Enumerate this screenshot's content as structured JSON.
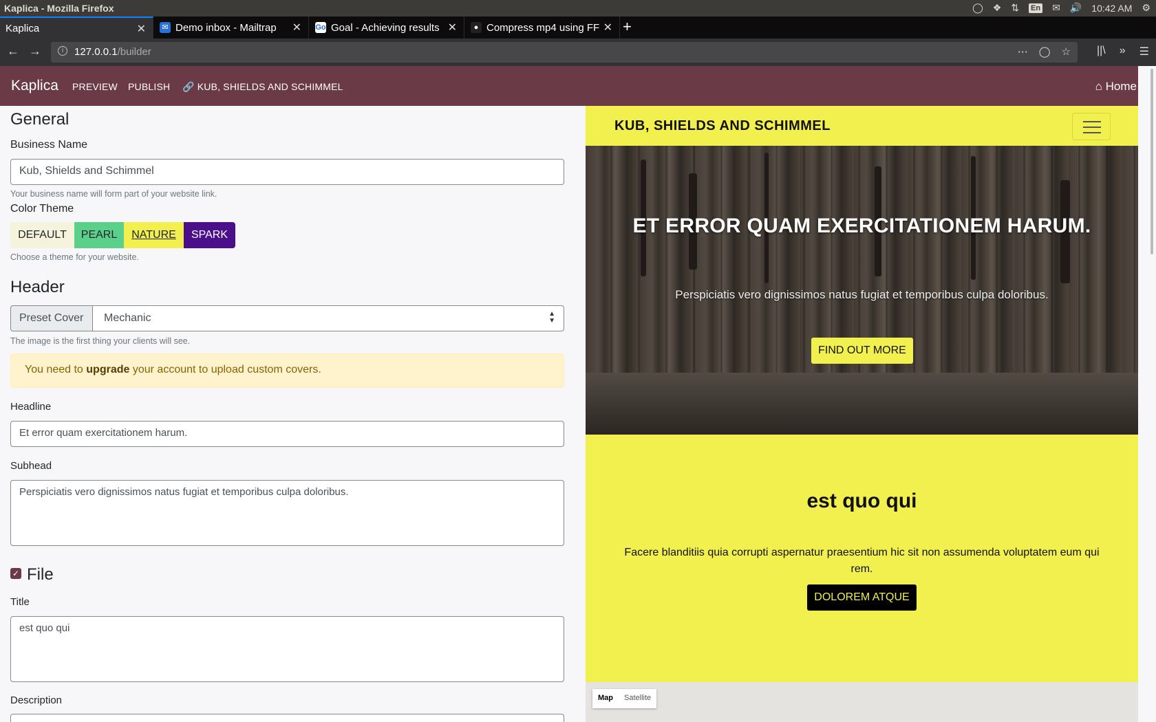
{
  "os": {
    "window_title": "Kaplica - Mozilla Firefox",
    "keyboard": "En",
    "clock": "10:42 AM"
  },
  "tabs": [
    {
      "label": "Kaplica",
      "icon": "page-icon",
      "active": true
    },
    {
      "label": "Demo inbox - Mailtrap",
      "icon": "mailtrap-icon"
    },
    {
      "label": "Goal - Achieving results",
      "icon": "go-icon"
    },
    {
      "label": "Compress mp4 using FF",
      "icon": "github-icon"
    }
  ],
  "browser": {
    "url_host": "127.0.0.1",
    "url_path": "/builder"
  },
  "app_nav": {
    "brand": "Kaplica",
    "preview": "PREVIEW",
    "publish": "PUBLISH",
    "site_link": "KUB, SHIELDS AND SCHIMMEL",
    "home": "Home"
  },
  "editor": {
    "general_heading": "General",
    "business_name_label": "Business Name",
    "business_name_value": "Kub, Shields and Schimmel",
    "business_name_help": "Your business name will form part of your website link.",
    "color_theme_label": "Color Theme",
    "themes": [
      {
        "label": "DEFAULT",
        "bg": "#f5f3dc",
        "fg": "#212529"
      },
      {
        "label": "PEARL",
        "bg": "#5bd08a",
        "fg": "#212529"
      },
      {
        "label": "NATURE",
        "bg": "#f2f04f",
        "fg": "#212529"
      },
      {
        "label": "SPARK",
        "bg": "#4b0f8c",
        "fg": "#ffffff"
      }
    ],
    "color_theme_help": "Choose a theme for your website.",
    "header_heading": "Header",
    "preset_cover_label": "Preset Cover",
    "preset_cover_value": "Mechanic",
    "preset_cover_help": "The image is the first thing your clients will see.",
    "alert_prefix": "You need to",
    "alert_link": "upgrade",
    "alert_suffix": "your account to upload custom covers.",
    "headline_label": "Headline",
    "headline_value": "Et error quam exercitationem harum.",
    "subhead_label": "Subhead",
    "subhead_value": "Perspiciatis vero dignissimos natus fugiat et temporibus culpa doloribus.",
    "file_heading": "File",
    "file_checked": true,
    "title_label": "Title",
    "title_value": "est quo qui",
    "description_label": "Description"
  },
  "preview": {
    "brand": "KUB, SHIELDS AND SCHIMMEL",
    "headline": "ET ERROR QUAM EXERCITATIONEM HARUM.",
    "subhead": "Perspiciatis vero dignissimos natus fugiat et temporibus culpa doloribus.",
    "cta": "FIND OUT MORE",
    "section_title": "est quo qui",
    "section_desc": "Facere blanditiis quia corrupti aspernatur praesentium hic sit non assumenda voluptatem eum qui rem.",
    "section_button": "DOLOREM ATQUE",
    "map_type_map": "Map",
    "map_type_satellite": "Satellite"
  },
  "colors": {
    "app_nav_bg": "#6b3a47",
    "theme_accent": "#f2f04f"
  }
}
